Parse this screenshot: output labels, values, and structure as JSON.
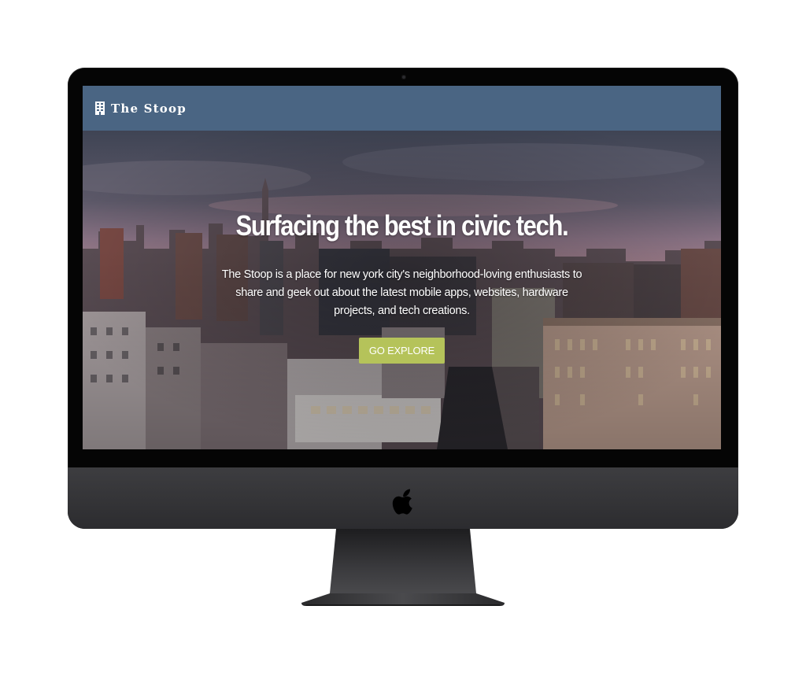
{
  "site": {
    "logo_text": "The Stoop",
    "logo_icon": "building-icon"
  },
  "hero": {
    "title": "Surfacing the best in civic tech.",
    "lines": [
      "The Stoop is a place for new york city's neighborhood-loving enthusiasts to",
      "share and geek out about the latest mobile apps, websites, hardware",
      "projects, and tech creations."
    ],
    "button_label": "GO EXPLORE"
  },
  "colors": {
    "header_bg": "#4a6583",
    "button_bg": "#b5c35a",
    "monitor_bezel": "#050505",
    "monitor_chin": "#38383b"
  },
  "device": {
    "logo_icon": "apple-icon"
  }
}
